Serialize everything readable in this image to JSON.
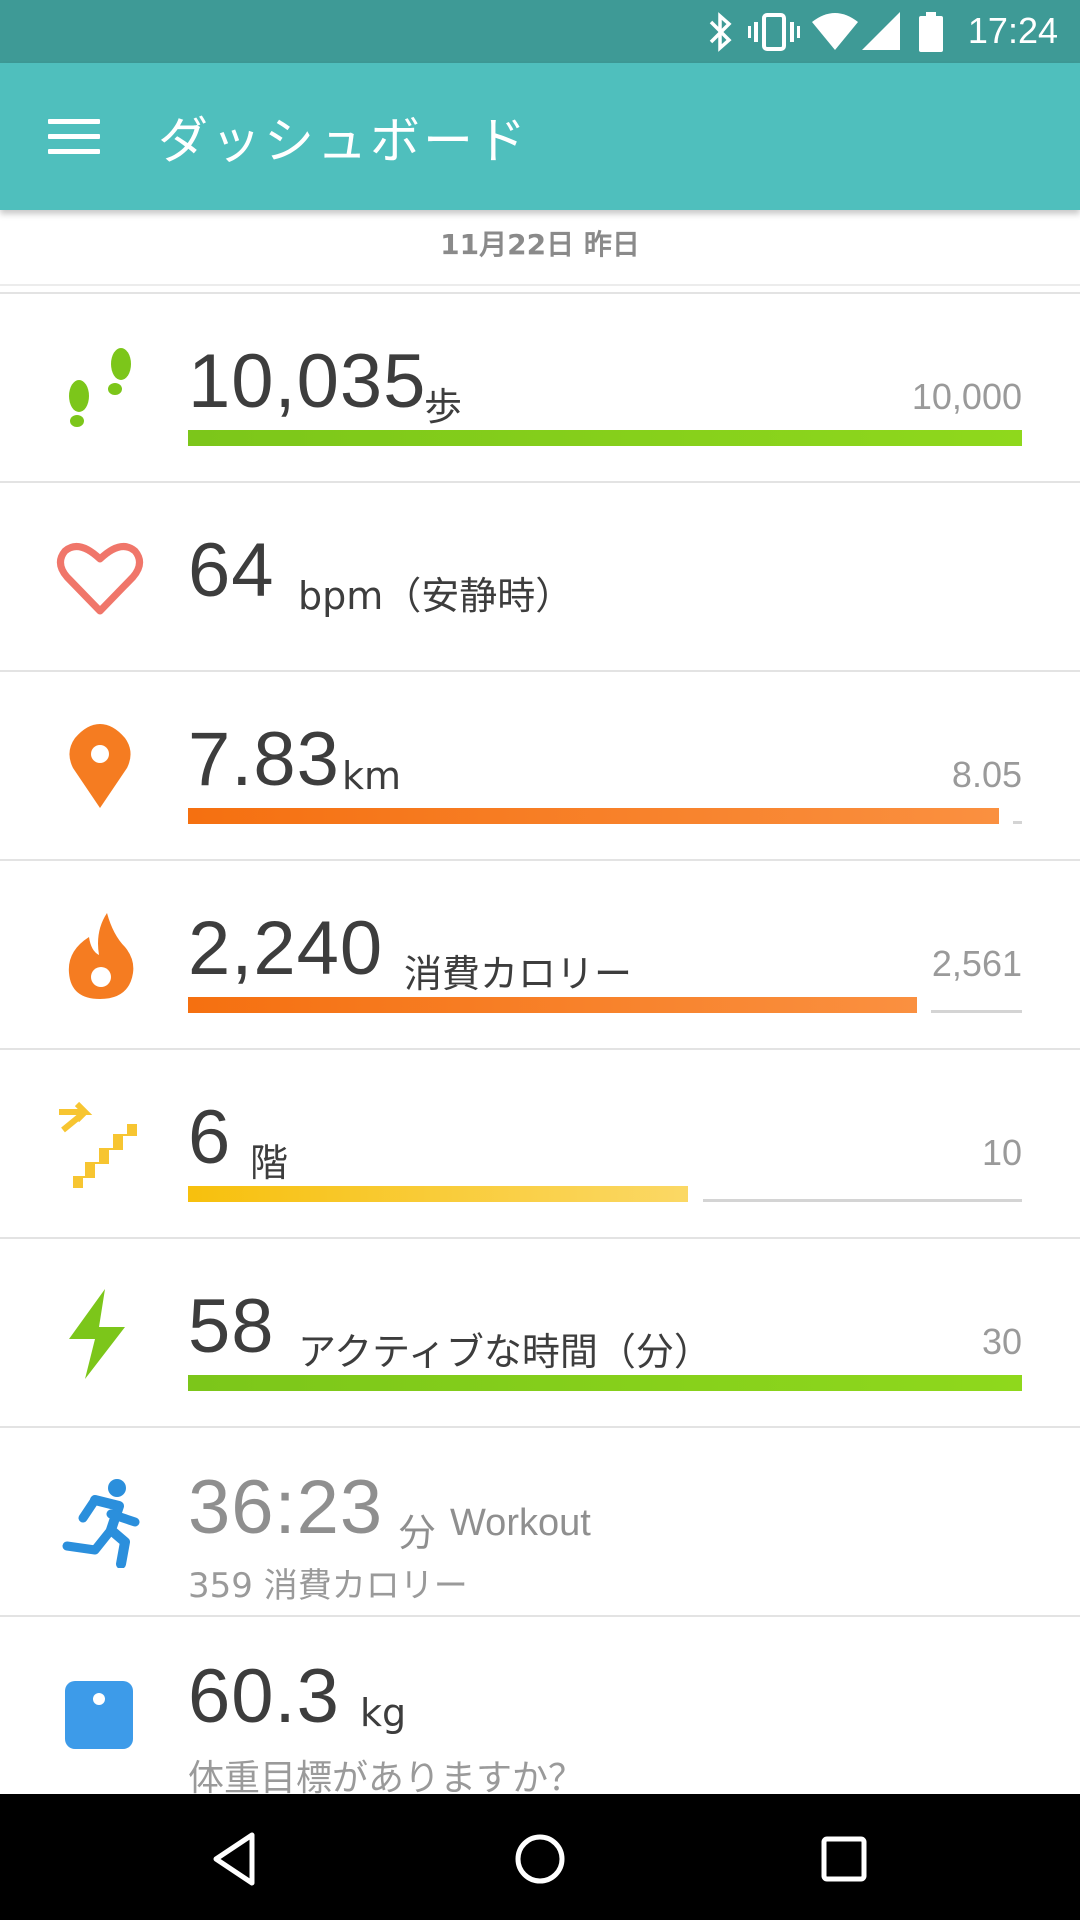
{
  "status_bar": {
    "time": "17:24",
    "icons": [
      "bluetooth-icon",
      "vibrate-icon",
      "wifi-icon",
      "signal-icon",
      "battery-icon"
    ]
  },
  "app_bar": {
    "title": "ダッシュボード",
    "menu_icon": "menu-icon"
  },
  "date_label": "11月22日 昨日",
  "stats": {
    "steps": {
      "value": "10,035",
      "unit": "歩",
      "goal": "10,000",
      "progress": 1.0,
      "color": "#7cc61a"
    },
    "heart": {
      "value": "64",
      "unit": "bpm（安静時）",
      "color": "#f0766a"
    },
    "distance": {
      "value": "7.83",
      "unit": "km",
      "goal": "8.05",
      "progress": 0.973,
      "color": "#f57c21"
    },
    "calories": {
      "value": "2,240",
      "unit": "消費カロリー",
      "goal": "2,561",
      "progress": 0.875,
      "color": "#f57c21"
    },
    "floors": {
      "value": "6",
      "unit": "階",
      "goal": "10",
      "progress": 0.6,
      "color": "#f7c531"
    },
    "active": {
      "value": "58",
      "unit": "アクティブな時間（分）",
      "goal": "30",
      "progress": 1.0,
      "color": "#7cc61a"
    },
    "workout": {
      "value": "36:23",
      "unit": "分",
      "label": "Workout",
      "sub_value": "359",
      "sub_unit": "消費カロリー",
      "color": "#2b8fdc"
    },
    "weight": {
      "value": "60.3",
      "unit": "kg",
      "sub": "体重目標がありますか？",
      "color": "#3d9be9"
    }
  },
  "nav": [
    "back-icon",
    "home-icon",
    "recents-icon"
  ]
}
